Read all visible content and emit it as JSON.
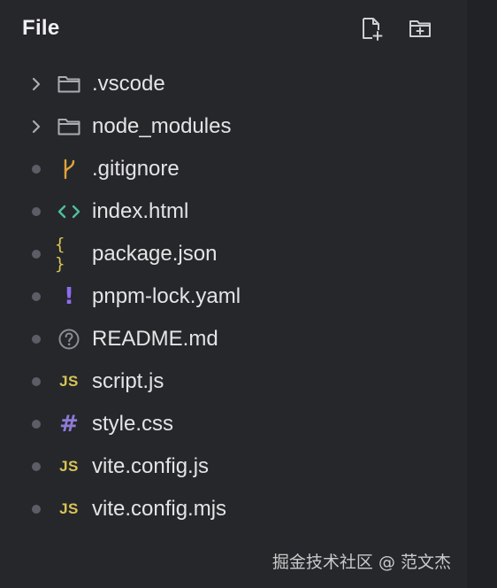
{
  "header": {
    "title": "File",
    "new_file_icon": "new-file-icon",
    "new_folder_icon": "new-folder-icon"
  },
  "tree": {
    "items": [
      {
        "label": ".vscode",
        "kind": "folder",
        "icon": "folder-icon",
        "lead": "chevron-right-icon"
      },
      {
        "label": "node_modules",
        "kind": "folder",
        "icon": "folder-icon",
        "lead": "chevron-right-icon"
      },
      {
        "label": ".gitignore",
        "kind": "file",
        "icon": "git-branch-icon",
        "lead": "dot"
      },
      {
        "label": "index.html",
        "kind": "file",
        "icon": "code-brackets-icon",
        "lead": "dot"
      },
      {
        "label": "package.json",
        "kind": "file",
        "icon": "json-braces-icon",
        "icon_text": "{ }",
        "lead": "dot"
      },
      {
        "label": "pnpm-lock.yaml",
        "kind": "file",
        "icon": "exclamation-icon",
        "icon_text": "!",
        "lead": "dot"
      },
      {
        "label": "README.md",
        "kind": "file",
        "icon": "question-circle-icon",
        "lead": "dot"
      },
      {
        "label": "script.js",
        "kind": "file",
        "icon": "js-icon",
        "icon_text": "JS",
        "lead": "dot"
      },
      {
        "label": "style.css",
        "kind": "file",
        "icon": "hash-icon",
        "icon_text": "#",
        "lead": "dot"
      },
      {
        "label": "vite.config.js",
        "kind": "file",
        "icon": "js-icon",
        "icon_text": "JS",
        "lead": "dot"
      },
      {
        "label": "vite.config.mjs",
        "kind": "file",
        "icon": "js-icon",
        "icon_text": "JS",
        "lead": "dot"
      }
    ]
  },
  "watermark": "掘金技术社区 @ 范文杰",
  "colors": {
    "panel_bg": "#25272b",
    "text": "#e4e4e4",
    "git": "#e0a23c",
    "html": "#4fbf9a",
    "json": "#d8c454",
    "yaml": "#8f6cf0",
    "css": "#8f7ad6",
    "js": "#d8c454",
    "muted": "#8a8d93"
  }
}
